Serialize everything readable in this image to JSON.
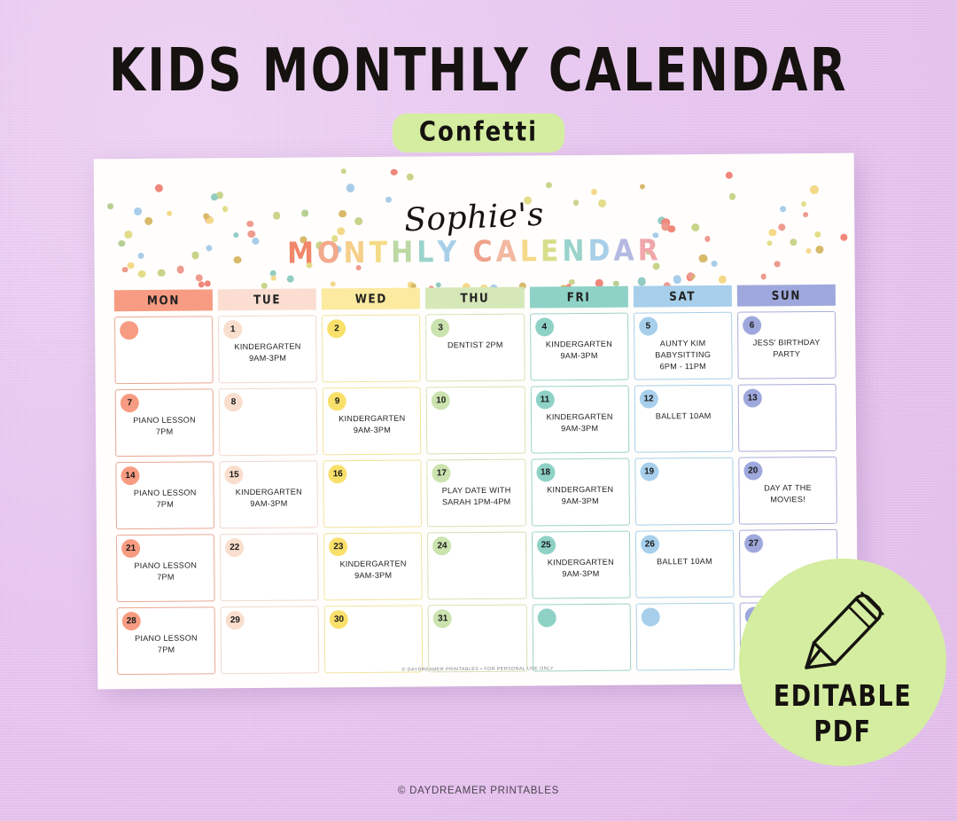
{
  "headline": {
    "title": "KIDS MONTHLY CALENDAR",
    "subtitle": "Confetti",
    "subtitle_bg": "#d4eda0"
  },
  "sheet": {
    "owner_name": "Sophie's",
    "sub_title_letters": [
      {
        "ch": "M",
        "color": "#f0866a"
      },
      {
        "ch": "O",
        "color": "#f2a98c"
      },
      {
        "ch": "N",
        "color": "#f6cf8a"
      },
      {
        "ch": "T",
        "color": "#f4dc86"
      },
      {
        "ch": "H",
        "color": "#bcd8a4"
      },
      {
        "ch": "L",
        "color": "#9ad3cc"
      },
      {
        "ch": "Y",
        "color": "#a8cfe8"
      },
      {
        "ch": " ",
        "color": "#ffffff"
      },
      {
        "ch": "C",
        "color": "#f0a28c"
      },
      {
        "ch": "A",
        "color": "#f2b9a0"
      },
      {
        "ch": "L",
        "color": "#f4d98a"
      },
      {
        "ch": "E",
        "color": "#d9de8c"
      },
      {
        "ch": "N",
        "color": "#9ad3cc"
      },
      {
        "ch": "D",
        "color": "#a8cfe8"
      },
      {
        "ch": "A",
        "color": "#b4b8e2"
      },
      {
        "ch": "R",
        "color": "#f0a6ab"
      }
    ],
    "footer": "© DAYDREAMER PRINTABLES • FOR PERSONAL USE ONLY"
  },
  "day_headers": [
    {
      "label": "MON",
      "bg": "#f79c82"
    },
    {
      "label": "TUE",
      "bg": "#fbded1"
    },
    {
      "label": "WED",
      "bg": "#fbeaa0"
    },
    {
      "label": "THU",
      "bg": "#d7e8b8"
    },
    {
      "label": "FRI",
      "bg": "#8ed2c6"
    },
    {
      "label": "SAT",
      "bg": "#a7cfec"
    },
    {
      "label": "SUN",
      "bg": "#9fa8dc"
    }
  ],
  "column_colors": [
    {
      "border": "#e8a893",
      "circle": "#f79c82"
    },
    {
      "border": "#f0d8cc",
      "circle": "#fadecd"
    },
    {
      "border": "#f2e39a",
      "circle": "#f8e06a"
    },
    {
      "border": "#d3e3b6",
      "circle": "#cbe3ae"
    },
    {
      "border": "#9cd3c8",
      "circle": "#8ed2c6"
    },
    {
      "border": "#a9cfe9",
      "circle": "#a7cfec"
    },
    {
      "border": "#a8add9",
      "circle": "#9fa8dc"
    }
  ],
  "weeks": [
    [
      {
        "num": "",
        "event": ""
      },
      {
        "num": "1",
        "event": "KINDERGARTEN\n9AM-3PM"
      },
      {
        "num": "2",
        "event": ""
      },
      {
        "num": "3",
        "event": "DENTIST 2PM"
      },
      {
        "num": "4",
        "event": "KINDERGARTEN\n9AM-3PM"
      },
      {
        "num": "5",
        "event": "AUNTY KIM\nBABYSITTING\n6PM - 11PM"
      },
      {
        "num": "6",
        "event": "JESS' BIRTHDAY\nPARTY"
      }
    ],
    [
      {
        "num": "7",
        "event": "PIANO LESSON\n7PM"
      },
      {
        "num": "8",
        "event": ""
      },
      {
        "num": "9",
        "event": "KINDERGARTEN\n9AM-3PM"
      },
      {
        "num": "10",
        "event": ""
      },
      {
        "num": "11",
        "event": "KINDERGARTEN\n9AM-3PM"
      },
      {
        "num": "12",
        "event": "BALLET 10AM"
      },
      {
        "num": "13",
        "event": ""
      }
    ],
    [
      {
        "num": "14",
        "event": "PIANO LESSON\n7PM"
      },
      {
        "num": "15",
        "event": "KINDERGARTEN\n9AM-3PM"
      },
      {
        "num": "16",
        "event": ""
      },
      {
        "num": "17",
        "event": "PLAY DATE WITH\nSARAH 1PM-4PM"
      },
      {
        "num": "18",
        "event": "KINDERGARTEN\n9AM-3PM"
      },
      {
        "num": "19",
        "event": ""
      },
      {
        "num": "20",
        "event": "DAY AT THE\nMOVIES!"
      }
    ],
    [
      {
        "num": "21",
        "event": "PIANO LESSON\n7PM"
      },
      {
        "num": "22",
        "event": ""
      },
      {
        "num": "23",
        "event": "KINDERGARTEN\n9AM-3PM"
      },
      {
        "num": "24",
        "event": ""
      },
      {
        "num": "25",
        "event": "KINDERGARTEN\n9AM-3PM"
      },
      {
        "num": "26",
        "event": "BALLET 10AM"
      },
      {
        "num": "27",
        "event": ""
      }
    ],
    [
      {
        "num": "28",
        "event": "PIANO LESSON\n7PM"
      },
      {
        "num": "29",
        "event": ""
      },
      {
        "num": "30",
        "event": ""
      },
      {
        "num": "31",
        "event": ""
      },
      {
        "num": "",
        "event": ""
      },
      {
        "num": "",
        "event": ""
      },
      {
        "num": "",
        "event": ""
      }
    ]
  ],
  "badge": {
    "line1": "EDITABLE",
    "line2": "PDF",
    "bg": "#d4eda0",
    "icon": "pencil-icon"
  },
  "page_footer": "© DAYDREAMER PRINTABLES",
  "confetti_palette": [
    "#f0877a",
    "#ef9a8e",
    "#f5d98a",
    "#e3dd8a",
    "#a9cde8",
    "#92ccc3",
    "#b7cf93",
    "#d8b96a",
    "#c9d48a"
  ]
}
